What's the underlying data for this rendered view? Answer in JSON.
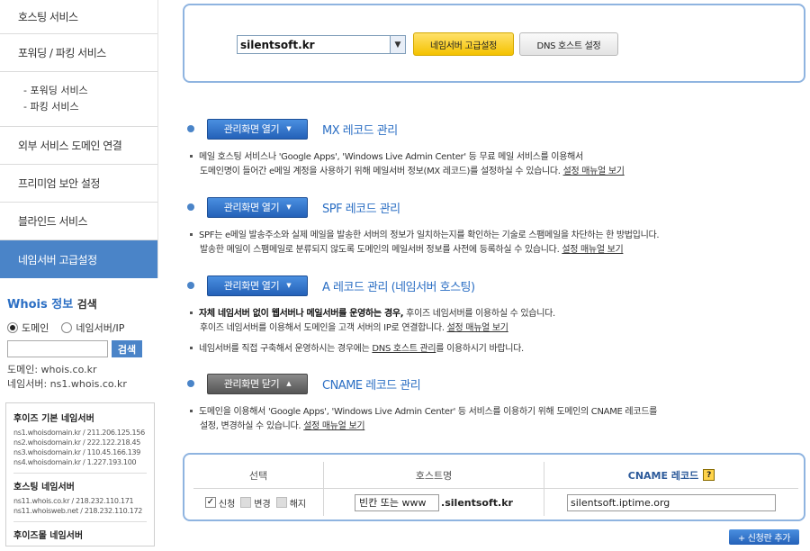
{
  "sidebar": {
    "menu": [
      {
        "label": "호스팅 서비스"
      },
      {
        "label": "포워딩 / 파킹 서비스"
      }
    ],
    "submenu": [
      "- 포워딩 서비스",
      "- 파킹 서비스"
    ],
    "menu2": [
      {
        "label": "외부 서비스 도메인 연결"
      },
      {
        "label": "프리미엄 보안 설정"
      },
      {
        "label": "블라인드 서비스"
      }
    ],
    "active_label": "네임서버 고급설정"
  },
  "whois": {
    "title_blue": "Whois 정보",
    "title_black": "검색",
    "radio_domain": "도메인",
    "radio_ns": "네임서버/IP",
    "search_button": "검색",
    "domain_info": "도메인: whois.co.kr",
    "ns_info": "네임서버: ns1.whois.co.kr"
  },
  "ns_box": {
    "basic_title": "후이즈 기본 네임서버",
    "basic_lines": [
      "ns1.whoisdomain.kr / 211.206.125.156",
      "ns2.whoisdomain.kr / 222.122.218.45",
      "ns3.whoisdomain.kr / 110.45.166.139",
      "ns4.whoisdomain.kr / 1.227.193.100"
    ],
    "hosting_title": "호스팅 네임서버",
    "hosting_lines": [
      "ns11.whois.co.kr / 218.232.110.171",
      "ns11.whoisweb.net / 218.232.110.172"
    ],
    "parking_title": "후이즈몰 네임서버"
  },
  "top_panel": {
    "domain_value": "silentsoft.kr",
    "ns_button": "네임서버 고급설정",
    "dns_button": "DNS 호스트 설정"
  },
  "sections": {
    "mx": {
      "button": "관리화면 열기",
      "title": "MX 레코드 관리",
      "line1": "메일 호스팅 서비스나 'Google Apps', 'Windows Live Admin Center' 등 무료 메일 서비스를 이용해서",
      "line2": "도메인명이 들어간 e메일 계정을 사용하기 위해 메일서버 정보(MX 레코드)를 설정하실 수 있습니다.",
      "link": "설정 매뉴얼 보기"
    },
    "spf": {
      "button": "관리화면 열기",
      "title": "SPF 레코드 관리",
      "line1": "SPF는 e메일 발송주소와 실제 메일을 발송한 서버의 정보가 일치하는지를 확인하는 기술로 스팸메일을 차단하는 한 방법입니다.",
      "line2": "발송한 메일이 스팸메일로 분류되지 않도록 도메인의 메일서버 정보를 사전에 등록하실 수 있습니다.",
      "link": "설정 매뉴얼 보기"
    },
    "a": {
      "button": "관리화면 열기",
      "title": "A 레코드 관리 (네임서버 호스팅)",
      "line1_bold": "자체 네임서버 없이 웹서버나 메일서버를 운영하는 경우,",
      "line1_rest": " 후이즈 네임서버를 이용하실 수 있습니다.",
      "line2": "후이즈 네임서버를 이용해서 도메인을 고객 서버의 IP로 연결합니다.",
      "link": "설정 매뉴얼 보기",
      "line3_pre": "네임서버를 직접 구축해서 운영하시는 경우에는 ",
      "line3_link": "DNS 호스트 관리",
      "line3_post": "를 이용하시기 바랍니다."
    },
    "cname": {
      "button": "관리화면 닫기",
      "title": "CNAME 레코드 관리",
      "line1": "도메인을 이용해서 'Google Apps', 'Windows Live Admin Center' 등 서비스를 이용하기 위해 도메인의 CNAME 레코드를",
      "line2": "설정, 변경하실 수 있습니다.",
      "link": "설정 매뉴얼 보기"
    }
  },
  "cname_table": {
    "headers": [
      "선택",
      "호스트명",
      "CNAME 레코드"
    ],
    "help_mark": "?",
    "opt_new": "신청",
    "opt_change": "변경",
    "opt_delete": "해지",
    "host_value": "빈칸 또는 www",
    "host_suffix": ".silentsoft.kr",
    "cname_value": "silentsoft.iptime.org"
  },
  "add_button": "+ 신청란 추가"
}
